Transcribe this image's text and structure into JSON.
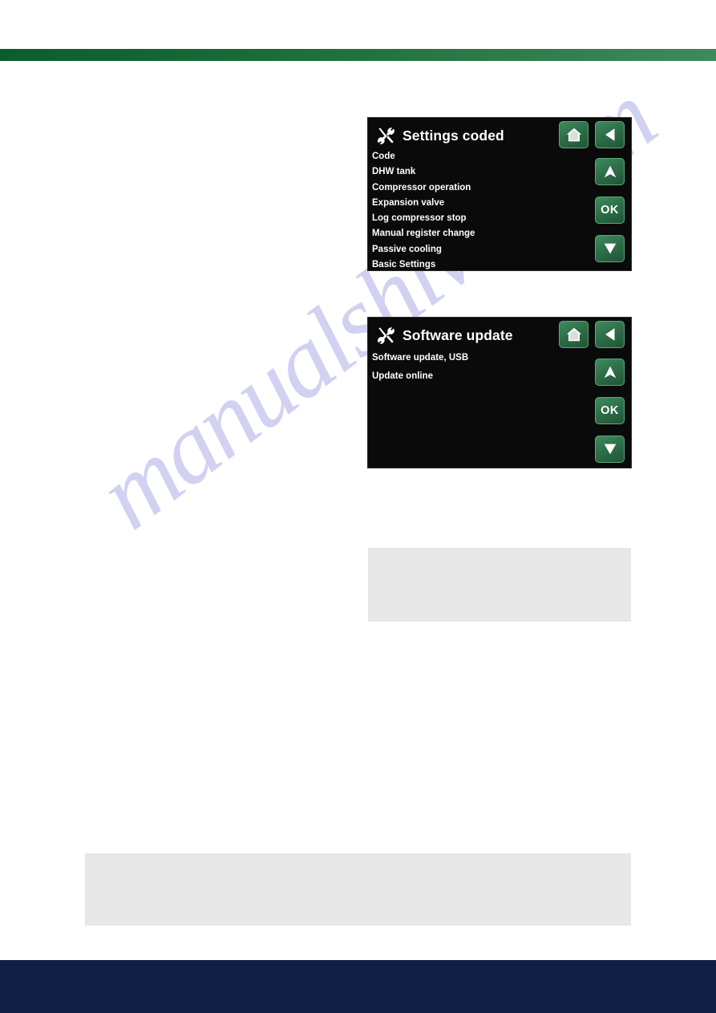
{
  "page": {
    "background_color": "#ffffff",
    "header_bar": {
      "gradient_from": "#0d5c2e",
      "gradient_to": "#3f8a5c"
    },
    "footer_bar": {
      "color": "#111f46"
    },
    "watermark": {
      "text": "manualshive.com",
      "color": "#c9c9ef"
    },
    "note_boxes": [
      {
        "name": "upper-note-box",
        "text": "",
        "color": "#e7e7e7"
      },
      {
        "name": "lower-note-box",
        "text": "",
        "color": "#e7e7e7"
      }
    ]
  },
  "screens": [
    {
      "id": "settings-coded",
      "title": "Settings coded",
      "title_icon": "tools-icon",
      "background_color": "#0a0a0a",
      "text_color": "#ffffff",
      "menu_items": [
        "Code",
        "DHW tank",
        "Compressor operation",
        "Expansion valve",
        "Log compressor stop",
        "Manual register change",
        "Passive cooling",
        "Basic Settings"
      ],
      "buttons": [
        {
          "name": "home-button",
          "icon": "home-icon",
          "label": ""
        },
        {
          "name": "back-button",
          "icon": "arrow-left-icon",
          "label": ""
        },
        {
          "name": "up-button",
          "icon": "arrow-up-icon",
          "label": ""
        },
        {
          "name": "ok-button",
          "icon": "ok-text",
          "label": "OK"
        },
        {
          "name": "down-button",
          "icon": "arrow-down-icon",
          "label": ""
        }
      ],
      "button_color": "#2e7049"
    },
    {
      "id": "software-update",
      "title": "Software update",
      "title_icon": "tools-icon",
      "background_color": "#0a0a0a",
      "text_color": "#ffffff",
      "menu_items": [
        "Software update, USB",
        "Update online"
      ],
      "buttons": [
        {
          "name": "home-button",
          "icon": "home-icon",
          "label": ""
        },
        {
          "name": "back-button",
          "icon": "arrow-left-icon",
          "label": ""
        },
        {
          "name": "up-button",
          "icon": "arrow-up-icon",
          "label": ""
        },
        {
          "name": "ok-button",
          "icon": "ok-text",
          "label": "OK"
        },
        {
          "name": "down-button",
          "icon": "arrow-down-icon",
          "label": ""
        }
      ],
      "button_color": "#2e7049"
    }
  ]
}
